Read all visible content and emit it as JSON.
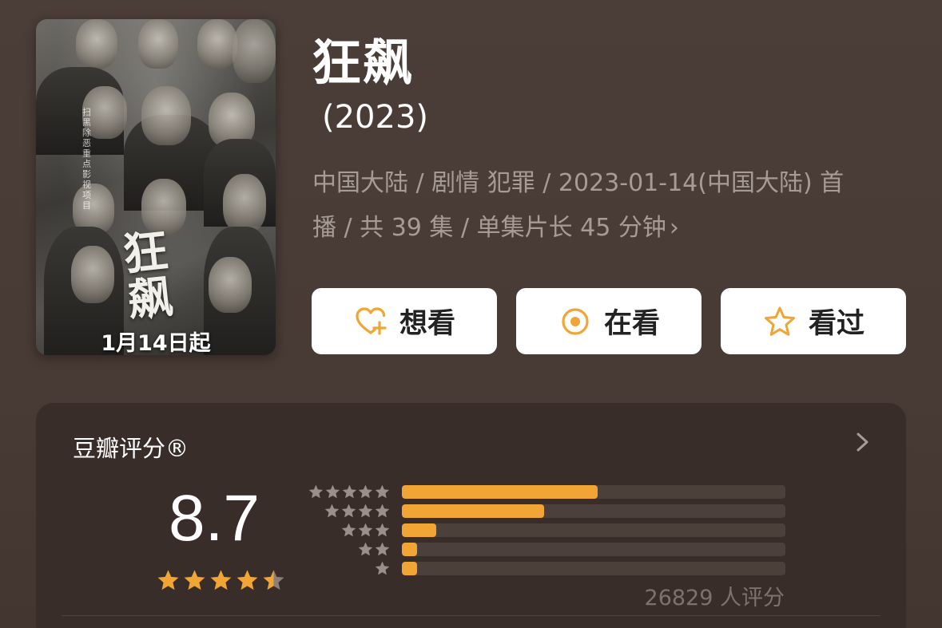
{
  "poster": {
    "title_text": "狂飙",
    "date_text": "1月14日起",
    "side_text": "扫黑除恶重点影视项目"
  },
  "header": {
    "title": "狂飙",
    "year": "(2023)",
    "meta_line1": "中国大陆 / 剧情 犯罪 / 2023-01-14(中国大陆) 首",
    "meta_line2": "播 / 共 39 集 / 单集片长 45 分钟",
    "meta_chevron": "›"
  },
  "actions": {
    "want_label": "想看",
    "watching_label": "在看",
    "watched_label": "看过",
    "want_icon": "heart-plus-icon",
    "watching_icon": "target-icon",
    "watched_icon": "star-outline-icon",
    "icon_color": "#f0a534"
  },
  "rating": {
    "label": "豆瓣评分®",
    "score": "8.7",
    "score_stars": 4.5,
    "count_text": "26829 人评分",
    "accent": "#f0a534",
    "distribution": [
      {
        "stars": 5,
        "fraction": 0.51
      },
      {
        "stars": 4,
        "fraction": 0.37
      },
      {
        "stars": 3,
        "fraction": 0.09
      },
      {
        "stars": 2,
        "fraction": 0.04
      },
      {
        "stars": 1,
        "fraction": 0.04
      }
    ]
  }
}
